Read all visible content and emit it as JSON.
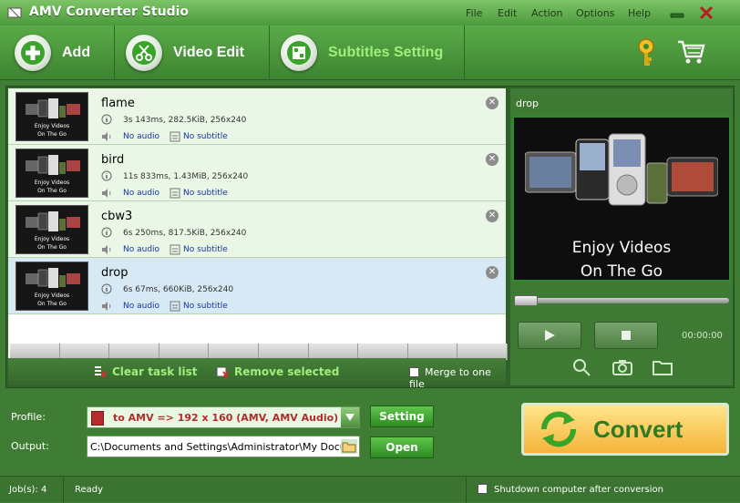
{
  "window": {
    "title": "AMV Converter Studio"
  },
  "menu": [
    "File",
    "Edit",
    "Action",
    "Options",
    "Help"
  ],
  "toolbar": {
    "add_label": "Add",
    "video_edit_label": "Video Edit",
    "subtitles_label": "Subtitles Setting"
  },
  "files": [
    {
      "name": "flame",
      "info": "3s 143ms, 282.5KiB, 256x240",
      "audio": "No audio",
      "subtitle": "No subtitle"
    },
    {
      "name": "bird",
      "info": "11s 833ms, 1.43MiB, 256x240",
      "audio": "No audio",
      "subtitle": "No subtitle"
    },
    {
      "name": "cbw3",
      "info": "6s 250ms, 817.5KiB, 256x240",
      "audio": "No audio",
      "subtitle": "No subtitle"
    },
    {
      "name": "drop",
      "info": "6s 67ms, 660KiB, 256x240",
      "audio": "No audio",
      "subtitle": "No subtitle"
    }
  ],
  "thumbnail_caption": [
    "Enjoy Videos",
    "On The Go"
  ],
  "list_actions": {
    "clear_label": "Clear task list",
    "remove_label": "Remove selected",
    "merge_label": "Merge to one file"
  },
  "preview": {
    "title": "drop",
    "caption_line1": "Enjoy Videos",
    "caption_line2": "On The Go",
    "time": "00:00:00"
  },
  "settings": {
    "profile_label": "Profile:",
    "profile_value": "to AMV => 192 x 160 (AMV, AMV Audio)",
    "output_label": "Output:",
    "output_value": "C:\\Documents and Settings\\Administrator\\My Documents\\",
    "setting_button": "Setting",
    "open_button": "Open",
    "convert_button": "Convert"
  },
  "status": {
    "jobs": "Job(s): 4",
    "state": "Ready",
    "shutdown_label": "Shutdown computer after conversion"
  },
  "colors": {
    "accent_green": "#9ff07a",
    "profile_red": "#b42b2b",
    "link_blue": "#1536a3"
  }
}
